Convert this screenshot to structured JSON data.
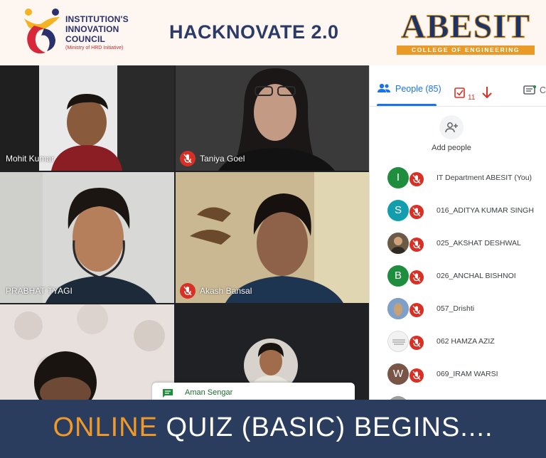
{
  "header": {
    "iic_lines": [
      "INSTITUTION'S",
      "INNOVATION",
      "COUNCIL"
    ],
    "iic_sub": "(Ministry of HRD Initiative)",
    "title": "HACKNOVATE 2.0",
    "college_name": "ABESIT",
    "college_sub": "COLLEGE OF ENGINEERING"
  },
  "participants": [
    {
      "name": "Mohit Kumar",
      "muted": false
    },
    {
      "name": "Taniya Goel",
      "muted": true
    },
    {
      "name": "PRABHAT TYAGI",
      "muted": false
    },
    {
      "name": "Akash Bansal",
      "muted": true
    },
    {
      "name": "",
      "muted": false
    },
    {
      "name": "",
      "muted": false
    }
  ],
  "panel": {
    "people_tab": "People (85)",
    "task_count": "11",
    "chat_tab": "Ch",
    "add_people": "Add people",
    "people": [
      {
        "initial": "I",
        "color": "#1e8e3e",
        "name": "IT Department ABESIT (You)"
      },
      {
        "initial": "S",
        "color": "#129eaf",
        "name": "016_ADITYA KUMAR SINGH"
      },
      {
        "initial": "",
        "color": "#6b5a46",
        "name": "025_AKSHAT DESHWAL"
      },
      {
        "initial": "B",
        "color": "#1e8e3e",
        "name": "026_ANCHAL BISHNOI"
      },
      {
        "initial": "",
        "color": "#5b7aa8",
        "name": "057_Drishti"
      },
      {
        "initial": "",
        "color": "#e8e8e8",
        "name": "062 HAMZA AZIZ"
      },
      {
        "initial": "W",
        "color": "#795548",
        "name": "069_IRAM WARSI"
      },
      {
        "initial": "",
        "color": "#9e9e9e",
        "name": ""
      }
    ]
  },
  "chat_toast": {
    "sender": "Aman Sengar"
  },
  "footer": {
    "accent": "ONLINE",
    "rest": " QUIZ (BASIC) BEGINS...."
  },
  "colors": {
    "brand_navy": "#2c3a68",
    "brand_orange": "#f19a2a",
    "meet_blue": "#1a73e8",
    "mute_red": "#d93025",
    "footer_bg": "#2b3d5e"
  }
}
